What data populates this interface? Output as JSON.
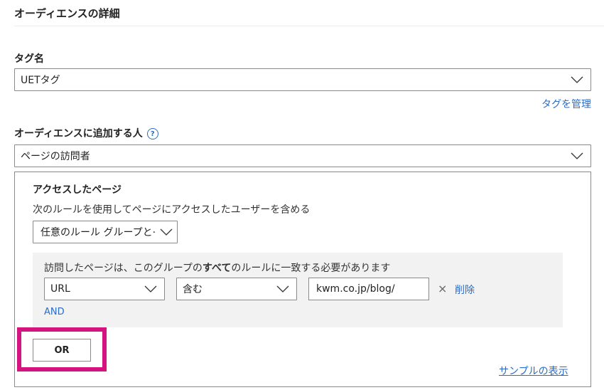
{
  "section_title": "オーディエンスの詳細",
  "tag_name": {
    "label": "タグ名",
    "selected": "UETタグ",
    "manage_link": "タグを管理"
  },
  "audience_add": {
    "label": "オーディエンスに追加する人",
    "help_icon": "?",
    "selected": "ページの訪問者"
  },
  "visited_pages": {
    "title": "アクセスしたページ",
    "description": "次のルールを使用してページにアクセスしたユーザーを含める",
    "group_combinator": "任意のルール グループと·"
  },
  "rule_group": {
    "desc_prefix": "訪問したページは、このグループの",
    "desc_bold": "すべて",
    "desc_suffix": "のルールに一致する必要があります",
    "rule": {
      "field": "URL",
      "operator": "含む",
      "value": "kwm.co.jp/blog/",
      "delete_label": "削除",
      "delete_icon": "×"
    },
    "and_label": "AND"
  },
  "or_button": "OR",
  "sample_link": "サンプルの表示",
  "colors": {
    "link": "#2b6cc4",
    "highlight": "#d6147f",
    "group_bg": "#f2f2f2",
    "border": "#8a8a8a"
  }
}
